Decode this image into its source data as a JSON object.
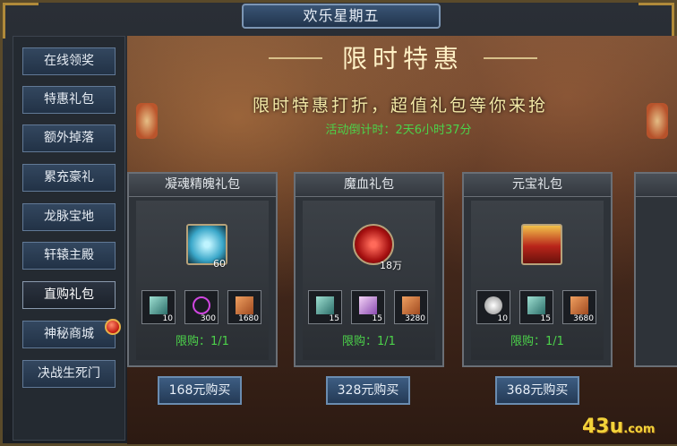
{
  "window": {
    "title": "欢乐星期五"
  },
  "sidebar": {
    "items": [
      {
        "label": "在线领奖",
        "active": false
      },
      {
        "label": "特惠礼包",
        "active": false
      },
      {
        "label": "额外掉落",
        "active": false
      },
      {
        "label": "累充豪礼",
        "active": false
      },
      {
        "label": "龙脉宝地",
        "active": false
      },
      {
        "label": "轩辕主殿",
        "active": false
      },
      {
        "label": "直购礼包",
        "active": true
      },
      {
        "label": "神秘商城",
        "active": false,
        "badge": "red-dot"
      },
      {
        "label": "决战生死门",
        "active": false
      }
    ]
  },
  "banner": {
    "title": "限时特惠",
    "subtitle": "限时特惠打折，超值礼包等你来抢",
    "countdown": "活动倒计时：2天6小时37分"
  },
  "packs": [
    {
      "name": "凝魂精魄礼包",
      "main": {
        "icon": "ice-crystal-icon",
        "qty": "60"
      },
      "items": [
        {
          "icon": "axe-icon",
          "qty": "10"
        },
        {
          "icon": "purple-orb-icon",
          "qty": "300"
        },
        {
          "icon": "book-icon",
          "qty": "1680"
        }
      ],
      "limit": "限购：1/1",
      "buy_label": "168元购买"
    },
    {
      "name": "魔血礼包",
      "main": {
        "icon": "blood-orb-icon",
        "qty": "18万"
      },
      "items": [
        {
          "icon": "axe-icon",
          "qty": "15"
        },
        {
          "icon": "wand-icon",
          "qty": "15"
        },
        {
          "icon": "book-icon",
          "qty": "3280"
        }
      ],
      "limit": "限购：1/1",
      "buy_label": "328元购买"
    },
    {
      "name": "元宝礼包",
      "main": {
        "icon": "treasure-chest-icon",
        "qty": ""
      },
      "items": [
        {
          "icon": "white-gem-icon",
          "qty": "10"
        },
        {
          "icon": "axe-icon",
          "qty": "15"
        },
        {
          "icon": "book-icon",
          "qty": "3680"
        }
      ],
      "limit": "限购：1/1",
      "buy_label": "368元购买"
    }
  ],
  "logo": {
    "text": "43u",
    "suffix": ".com"
  },
  "colors": {
    "accent_green": "#4cd24a",
    "gold": "#b7a27a",
    "button_blue": "#3d5d82"
  }
}
